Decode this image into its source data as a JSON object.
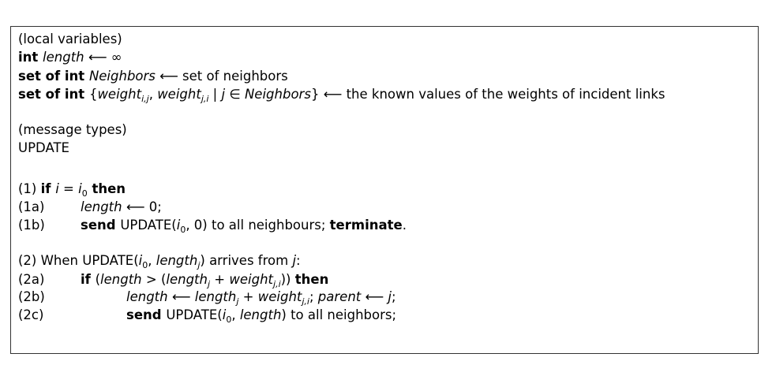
{
  "lines": [
    {
      "label": "",
      "indent": 0,
      "parts": [
        {
          "t": "(local variables)",
          "s": ""
        }
      ]
    },
    {
      "label": "",
      "indent": 0,
      "parts": [
        {
          "t": "int ",
          "s": "b"
        },
        {
          "t": "length",
          "s": "i"
        },
        {
          "t": " ⟵ ∞",
          "s": ""
        }
      ]
    },
    {
      "label": "",
      "indent": 0,
      "parts": [
        {
          "t": "set of int ",
          "s": "b"
        },
        {
          "t": "Neighbors",
          "s": "i"
        },
        {
          "t": " ⟵ set of neighbors",
          "s": ""
        }
      ]
    },
    {
      "label": "",
      "indent": 0,
      "parts": [
        {
          "t": "set of int ",
          "s": "b"
        },
        {
          "t": "{",
          "s": ""
        },
        {
          "t": "weight",
          "s": "i"
        },
        {
          "t": "i,j",
          "s": "subi"
        },
        {
          "t": ", ",
          "s": ""
        },
        {
          "t": "weight",
          "s": "i"
        },
        {
          "t": "j,i",
          "s": "subi"
        },
        {
          "t": " | ",
          "s": ""
        },
        {
          "t": "j",
          "s": "i"
        },
        {
          "t": " ∈ ",
          "s": ""
        },
        {
          "t": "Neighbors",
          "s": "i"
        },
        {
          "t": "} ⟵ the known values of the weights of incident links",
          "s": ""
        }
      ]
    },
    {
      "label": "",
      "indent": 0,
      "parts": [
        {
          "t": "(message types)",
          "s": ""
        }
      ]
    },
    {
      "label": "",
      "indent": 0,
      "parts": [
        {
          "t": "UPDATE",
          "s": ""
        }
      ]
    },
    {
      "label": "",
      "indent": 0,
      "parts": [
        {
          "t": "(1) ",
          "s": ""
        },
        {
          "t": "if ",
          "s": "b"
        },
        {
          "t": "i",
          "s": "i"
        },
        {
          "t": " = ",
          "s": ""
        },
        {
          "t": "i",
          "s": "i"
        },
        {
          "t": "0",
          "s": "sub"
        },
        {
          "t": " then",
          "s": "b"
        }
      ]
    },
    {
      "label": "(1a)",
      "indent": 1,
      "parts": [
        {
          "t": "length",
          "s": "i"
        },
        {
          "t": " ⟵ 0;",
          "s": ""
        }
      ]
    },
    {
      "label": "(1b)",
      "indent": 1,
      "parts": [
        {
          "t": "send ",
          "s": "b"
        },
        {
          "t": "UPDATE(",
          "s": ""
        },
        {
          "t": "i",
          "s": "i"
        },
        {
          "t": "0",
          "s": "sub"
        },
        {
          "t": ", 0) to all neighbours; ",
          "s": ""
        },
        {
          "t": "terminate",
          "s": "b"
        },
        {
          "t": ".",
          "s": ""
        }
      ]
    },
    {
      "label": "",
      "indent": 0,
      "parts": [
        {
          "t": "(2) When UPDATE(",
          "s": ""
        },
        {
          "t": "i",
          "s": "i"
        },
        {
          "t": "0",
          "s": "sub"
        },
        {
          "t": ", ",
          "s": ""
        },
        {
          "t": "length",
          "s": "i"
        },
        {
          "t": "j",
          "s": "subi"
        },
        {
          "t": ") arrives from ",
          "s": ""
        },
        {
          "t": "j",
          "s": "i"
        },
        {
          "t": ":",
          "s": ""
        }
      ]
    },
    {
      "label": "(2a)",
      "indent": 1,
      "parts": [
        {
          "t": "if ",
          "s": "b"
        },
        {
          "t": "(",
          "s": ""
        },
        {
          "t": "length",
          "s": "i"
        },
        {
          "t": " > (",
          "s": ""
        },
        {
          "t": "length",
          "s": "i"
        },
        {
          "t": "j",
          "s": "subi"
        },
        {
          "t": " + ",
          "s": ""
        },
        {
          "t": "weight",
          "s": "i"
        },
        {
          "t": "j,i",
          "s": "subi"
        },
        {
          "t": ")) ",
          "s": ""
        },
        {
          "t": "then",
          "s": "b"
        }
      ]
    },
    {
      "label": "(2b)",
      "indent": 2,
      "parts": [
        {
          "t": "length",
          "s": "i"
        },
        {
          "t": " ⟵ ",
          "s": ""
        },
        {
          "t": "length",
          "s": "i"
        },
        {
          "t": "j",
          "s": "subi"
        },
        {
          "t": " + ",
          "s": ""
        },
        {
          "t": "weight",
          "s": "i"
        },
        {
          "t": "j,i",
          "s": "subi"
        },
        {
          "t": "; ",
          "s": ""
        },
        {
          "t": "parent",
          "s": "i"
        },
        {
          "t": " ⟵ ",
          "s": ""
        },
        {
          "t": "j",
          "s": "i"
        },
        {
          "t": ";",
          "s": ""
        }
      ]
    },
    {
      "label": "(2c)",
      "indent": 2,
      "parts": [
        {
          "t": "send ",
          "s": "b"
        },
        {
          "t": "UPDATE(",
          "s": ""
        },
        {
          "t": "i",
          "s": "i"
        },
        {
          "t": "0",
          "s": "sub"
        },
        {
          "t": ", ",
          "s": ""
        },
        {
          "t": "length",
          "s": "i"
        },
        {
          "t": ") to all neighbors;",
          "s": ""
        }
      ]
    }
  ]
}
